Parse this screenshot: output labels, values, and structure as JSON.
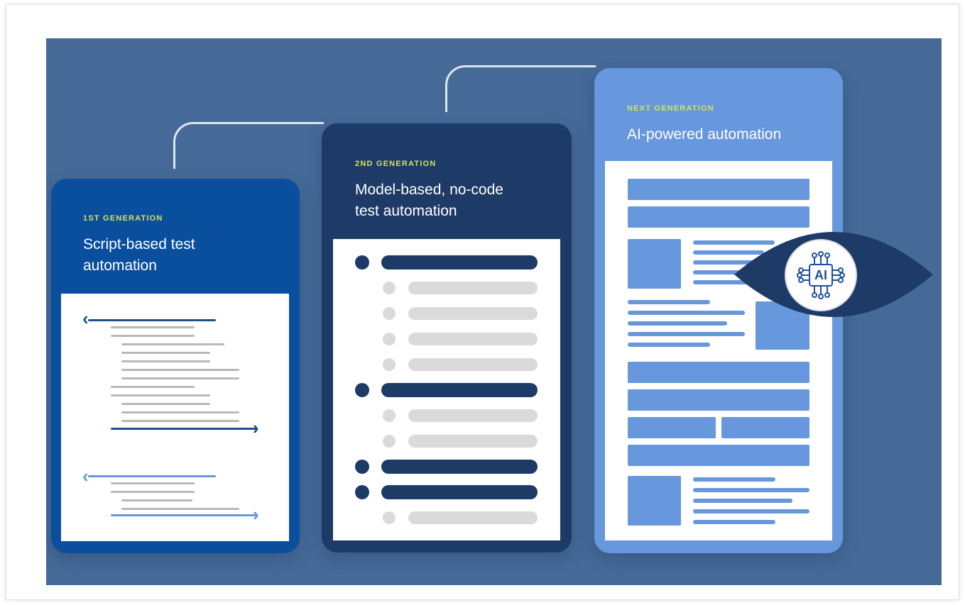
{
  "generations": [
    {
      "label": "1ST GENERATION",
      "title_line1": "Script-based test",
      "title_line2": "automation"
    },
    {
      "label": "2ND GENERATION",
      "title_line1": "Model-based, no-code",
      "title_line2": "test automation"
    },
    {
      "label": "NEXT GENERATION",
      "title_line1": "AI-powered automation",
      "title_line2": ""
    }
  ],
  "ai_badge": {
    "text": "AI",
    "icon": "ai-chip-icon"
  },
  "colors": {
    "background": "#456a98",
    "card_1st": "#0a4f9e",
    "card_2nd": "#1e3a66",
    "card_next": "#6797dc",
    "generation_label": "#d4e35a"
  }
}
